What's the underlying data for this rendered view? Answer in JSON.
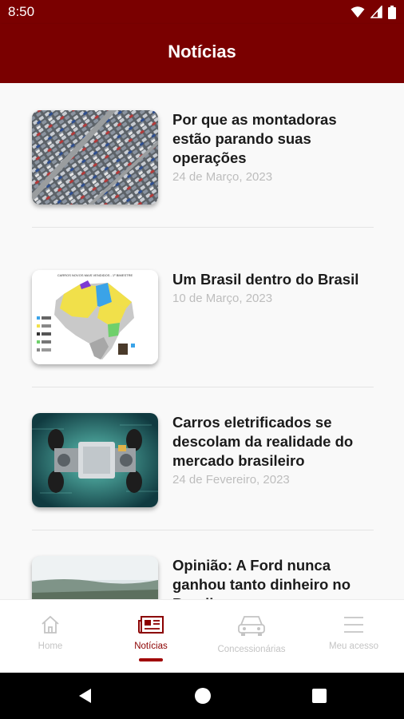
{
  "status": {
    "time": "8:50",
    "icons": [
      "wifi-icon",
      "signal-icon",
      "battery-icon"
    ]
  },
  "header": {
    "title": "Notícias"
  },
  "articles": [
    {
      "title": "Por que as montadoras estão parando suas operações",
      "date": "24 de Março, 2023",
      "thumb": "parking-lot-aerial"
    },
    {
      "title": "Um Brasil dentro do Brasil",
      "date": "10 de Março, 2023",
      "thumb": "brazil-map-chart"
    },
    {
      "title": "Carros eletrificados se descolam da realidade do mercado brasileiro",
      "date": "24 de Fevereiro, 2023",
      "thumb": "ev-chassis"
    },
    {
      "title": "Opinião: A Ford nunca ganhou tanto dinheiro no Brasil",
      "date": "",
      "thumb": "landscape"
    }
  ],
  "thumb_map": {
    "title": "CARROS NOVOS MAIS VENDIDOS - 1º BIMESTRE"
  },
  "bottom_nav": [
    {
      "label": "Home",
      "icon": "home-icon",
      "active": false
    },
    {
      "label": "Notícias",
      "icon": "newspaper-icon",
      "active": true
    },
    {
      "label": "Concessionárias",
      "icon": "car-icon",
      "active": false
    },
    {
      "label": "Meu acesso",
      "icon": "menu-icon",
      "active": false
    }
  ],
  "colors": {
    "primary": "#7a0000",
    "active": "#8b0000",
    "inactive": "#c4c4c4",
    "date": "#bdbdbd"
  }
}
